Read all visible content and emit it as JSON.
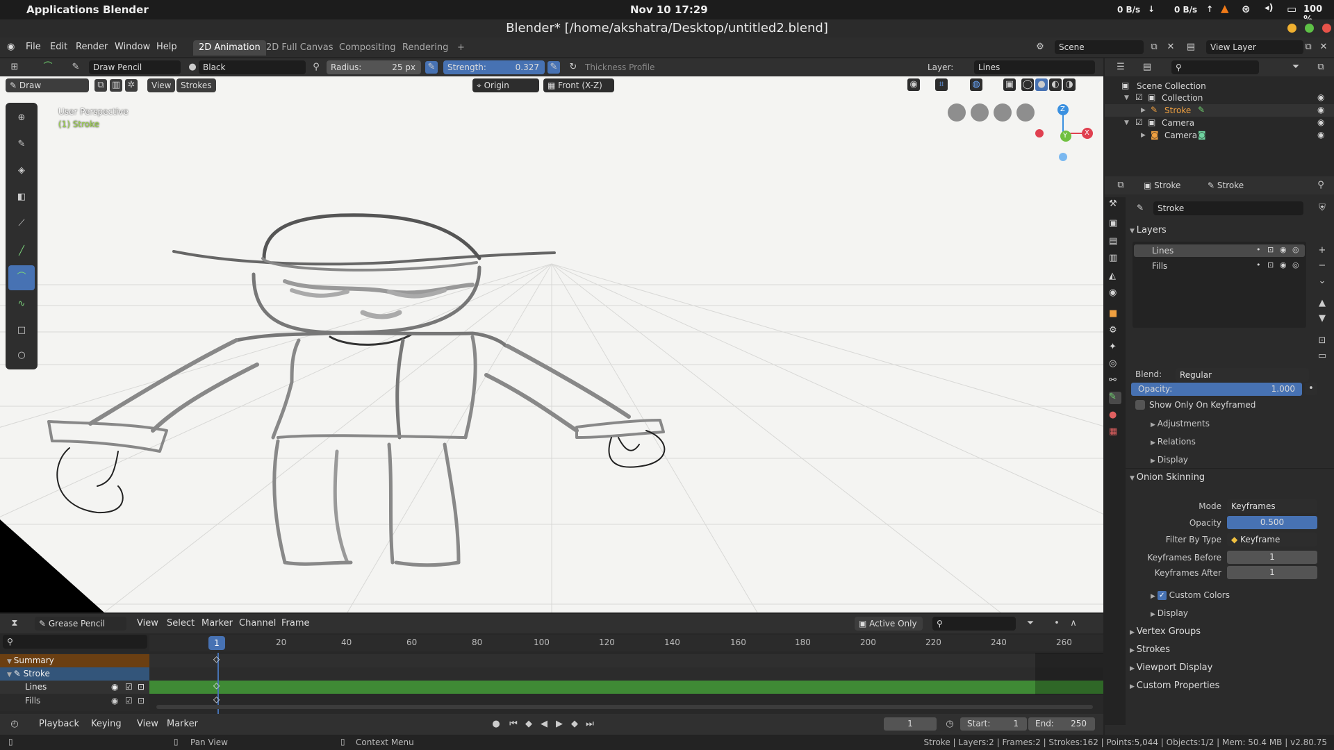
{
  "system_bar": {
    "apps": "Applications",
    "app_name": "Blender",
    "clock": "Nov 10  17:29",
    "net_down": "0 B/s",
    "net_up": "0 B/s",
    "battery": "100 %"
  },
  "window": {
    "title": "Blender* [/home/akshatra/Desktop/untitled2.blend]"
  },
  "menu": {
    "items": [
      "File",
      "Edit",
      "Render",
      "Window",
      "Help"
    ],
    "workspaces": [
      "2D Animation",
      "2D Full Canvas",
      "Compositing",
      "Rendering"
    ],
    "add_tab": "+",
    "scene_label": "Scene",
    "view_layer_label": "View Layer"
  },
  "tool_header": {
    "tool_name": "Draw Pencil",
    "material": "Black",
    "radius_label": "Radius:",
    "radius_value": "25 px",
    "strength_label": "Strength:",
    "strength_value": "0.327",
    "thickness_profile": "Thickness Profile",
    "layer_label": "Layer:",
    "layer_value": "Lines"
  },
  "viewport_header": {
    "mode": "Draw",
    "view": "View",
    "strokes": "Strokes",
    "origin": "Origin",
    "projection": "Front (X-Z)"
  },
  "viewport": {
    "perspective": "User Perspective",
    "object_label": "(1) Stroke",
    "gizmo": {
      "z": "Z",
      "y": "Y",
      "x": "X"
    }
  },
  "timeline": {
    "editor": "Grease Pencil",
    "menus": [
      "View",
      "Select",
      "Marker",
      "Channel",
      "Frame"
    ],
    "active_only": "Active Only",
    "current_frame_marker": "1",
    "ruler": [
      "20",
      "40",
      "60",
      "80",
      "100",
      "120",
      "140",
      "160",
      "180",
      "200",
      "220",
      "240",
      "260"
    ],
    "channels": [
      "Summary",
      "Stroke",
      "Lines",
      "Fills"
    ]
  },
  "playback": {
    "playback": "Playback",
    "keying": "Keying",
    "view": "View",
    "marker": "Marker",
    "current_frame": "1",
    "start_label": "Start:",
    "start_value": "1",
    "end_label": "End:",
    "end_value": "250"
  },
  "status": {
    "pan_view": "Pan View",
    "context_menu": "Context Menu",
    "stats": "Stroke | Layers:2 | Frames:2 | Strokes:162 | Points:5,044 | Objects:1/2 | Mem: 50.4 MB | v2.80.75"
  },
  "outliner": {
    "root": "Scene Collection",
    "items": [
      "Collection",
      "Stroke",
      "Camera",
      "Camera"
    ]
  },
  "properties": {
    "breadcrumb_obj": "Stroke",
    "breadcrumb_data": "Stroke",
    "datablock": "Stroke",
    "layers_title": "Layers",
    "layers": [
      "Lines",
      "Fills"
    ],
    "blend_label": "Blend:",
    "blend_value": "Regular",
    "opacity_label": "Opacity:",
    "opacity_value": "1.000",
    "show_keyframed": "Show Only On Keyframed",
    "adjustments": "Adjustments",
    "relations": "Relations",
    "display": "Display",
    "onion_title": "Onion Skinning",
    "mode_label": "Mode",
    "mode_value": "Keyframes",
    "onion_opacity_label": "Opacity",
    "onion_opacity_value": "0.500",
    "filter_label": "Filter By Type",
    "filter_value": "Keyframe",
    "kf_before_label": "Keyframes Before",
    "kf_before_value": "1",
    "kf_after_label": "Keyframes After",
    "kf_after_value": "1",
    "custom_colors": "Custom Colors",
    "display2": "Display",
    "vertex_groups": "Vertex Groups",
    "strokes": "Strokes",
    "viewport_display": "Viewport Display",
    "custom_props": "Custom Properties"
  },
  "colors": {
    "accent": "#4772b3",
    "keyframe_row": "#3f8a35",
    "summary_row": "#6b3f12",
    "active_row": "#33557a"
  }
}
